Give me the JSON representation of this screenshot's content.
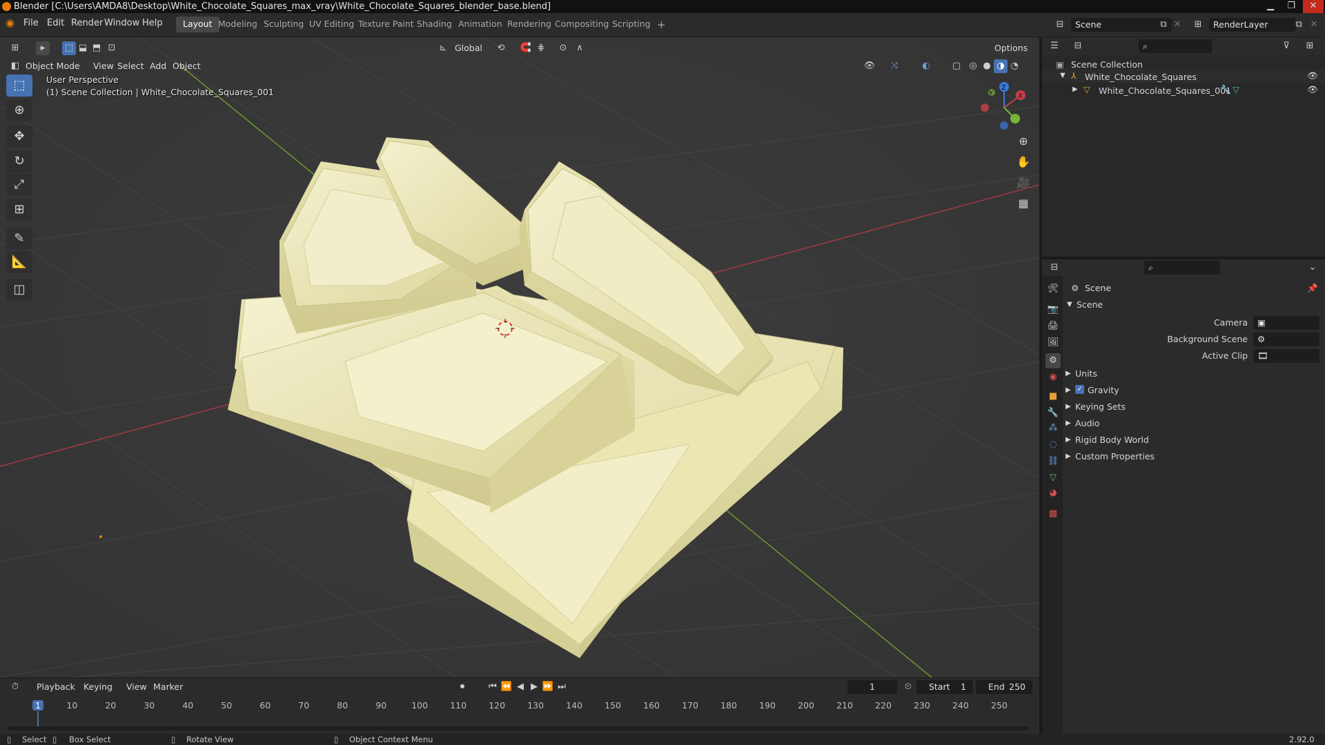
{
  "titlebar": {
    "title": "Blender [C:\\Users\\AMDA8\\Desktop\\White_Chocolate_Squares_max_vray\\White_Chocolate_Squares_blender_base.blend]",
    "minimize": "▁",
    "maximize": "❐",
    "close": "✕"
  },
  "menu": {
    "file": "File",
    "edit": "Edit",
    "render": "Render",
    "window": "Window",
    "help": "Help"
  },
  "workspaces": [
    "Layout",
    "Modeling",
    "Sculpting",
    "UV Editing",
    "Texture Paint",
    "Shading",
    "Animation",
    "Rendering",
    "Compositing",
    "Scripting"
  ],
  "active_workspace": "Layout",
  "add_workspace": "+",
  "scene_field": "Scene",
  "viewlayer_field": "RenderLayer",
  "viewport_header": {
    "transform_orientation": "Global",
    "options": "Options",
    "mode": "Object Mode",
    "view": "View",
    "select": "Select",
    "add": "Add",
    "object": "Object"
  },
  "viewport_overlay": {
    "perspective": "User Perspective",
    "collection": "(1) Scene Collection | White_Chocolate_Squares_001"
  },
  "gizmo": {
    "x": "X",
    "y": "Y",
    "z": "Z"
  },
  "tools": [
    "select-box",
    "cursor",
    "move",
    "rotate",
    "scale",
    "transform",
    "annotate",
    "measure",
    "add-cube"
  ],
  "timeline": {
    "playback": "Playback",
    "keying": "Keying",
    "view": "View",
    "marker": "Marker",
    "current_frame": "1",
    "start_label": "Start",
    "start": "1",
    "end_label": "End",
    "end": "250",
    "ticks": [
      "1",
      "10",
      "20",
      "30",
      "40",
      "50",
      "60",
      "70",
      "80",
      "90",
      "100",
      "110",
      "120",
      "130",
      "140",
      "150",
      "160",
      "170",
      "180",
      "190",
      "200",
      "210",
      "220",
      "230",
      "240",
      "250"
    ]
  },
  "outliner": {
    "root": "Scene Collection",
    "items": [
      {
        "label": "White_Chocolate_Squares"
      },
      {
        "label": "White_Chocolate_Squares_001"
      }
    ]
  },
  "properties": {
    "context": "Scene",
    "panel": "Scene",
    "camera_label": "Camera",
    "background_scene_label": "Background Scene",
    "active_clip_label": "Active Clip",
    "sections": [
      "Units",
      "Gravity",
      "Keying Sets",
      "Audio",
      "Rigid Body World",
      "Custom Properties"
    ],
    "gravity_checked": true
  },
  "statusbar": {
    "select": "Select",
    "box_select": "Box Select",
    "rotate_view": "Rotate View",
    "context_menu": "Object Context Menu",
    "version": "2.92.0"
  },
  "colors": {
    "accent": "#4772b3",
    "x_axis": "#c8404a",
    "y_axis": "#7ab33a",
    "z_axis": "#3a7be0",
    "chocolate": "#ece8b8"
  }
}
